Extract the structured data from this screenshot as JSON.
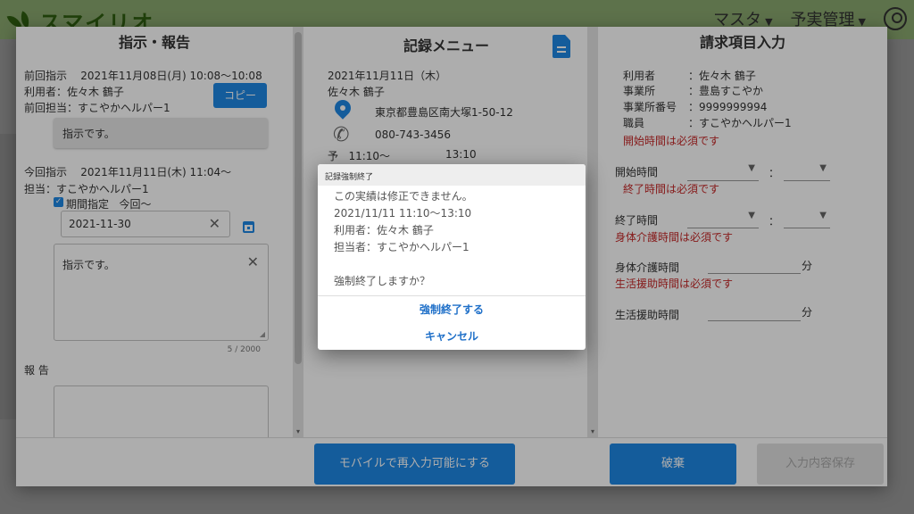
{
  "app": {
    "logo": "スマイリオ",
    "nav": [
      "マスタ",
      "予実管理"
    ]
  },
  "instructions": {
    "title": "指示・報告",
    "prev_label": "前回指示",
    "prev_datetime": "2021年11月08日(月) 10:08〜10:08",
    "user_label": "利用者：",
    "user_name": "佐々木 鶴子",
    "copy_button": "コピー",
    "prev_staff_label": "前回担当：",
    "prev_staff_name": "すこやかヘルパー1",
    "prev_note": "指示です。",
    "current_label": "今回指示",
    "current_datetime": "2021年11月11日(木) 11:04〜",
    "staff_label": "担当：",
    "staff_name": "すこやかヘルパー1",
    "period_label": "期間指定",
    "period_value": "今回〜",
    "date_value": "2021-11-30",
    "instruction_text": "指示です。",
    "counter": "5 / 2000",
    "report_label": "報 告"
  },
  "record_menu": {
    "title": "記録メニュー",
    "date": "2021年11月11日（木）",
    "user_name": "佐々木 鶴子",
    "address": "東京都豊島区南大塚1-50-12",
    "phone": "080-743-3456",
    "plan_label": "予",
    "plan_start": "11:10〜",
    "plan_end": "13:10"
  },
  "billing": {
    "title": "請求項目入力",
    "info": [
      {
        "label": "利用者",
        "value": "：佐々木 鶴子"
      },
      {
        "label": "事業所",
        "value": "：豊島すこやか"
      },
      {
        "label": "事業所番号",
        "value": "：9999999994"
      },
      {
        "label": "職員",
        "value": "：すこやかヘルパー1"
      }
    ],
    "error_start_top": "開始時間は必須です",
    "start_label": "開始時間",
    "error_end": "終了時間は必須です",
    "end_label": "終了時間",
    "error_body_care": "身体介護時間は必須です",
    "body_care_label": "身体介護時間",
    "error_life_support": "生活援助時間は必須です",
    "life_support_label": "生活援助時間",
    "colon": "：",
    "unit_min": "分"
  },
  "footer": {
    "mobile_button": "モバイルで再入力可能にする",
    "discard_button": "破棄",
    "save_button": "入力内容保存"
  },
  "confirm": {
    "title": "記録強制終了",
    "line1": "この実績は修正できません。",
    "line2": "2021/11/11 11:10〜13:10",
    "line3": "利用者：佐々木 鶴子",
    "line4": "担当者：すこやかヘルパー1",
    "line5": "強制終了しますか？",
    "ok_button": "強制終了する",
    "cancel_button": "キャンセル"
  },
  "colors": {
    "primary": "#1e88e5",
    "error": "#c62828",
    "header": "#8aa86f"
  }
}
